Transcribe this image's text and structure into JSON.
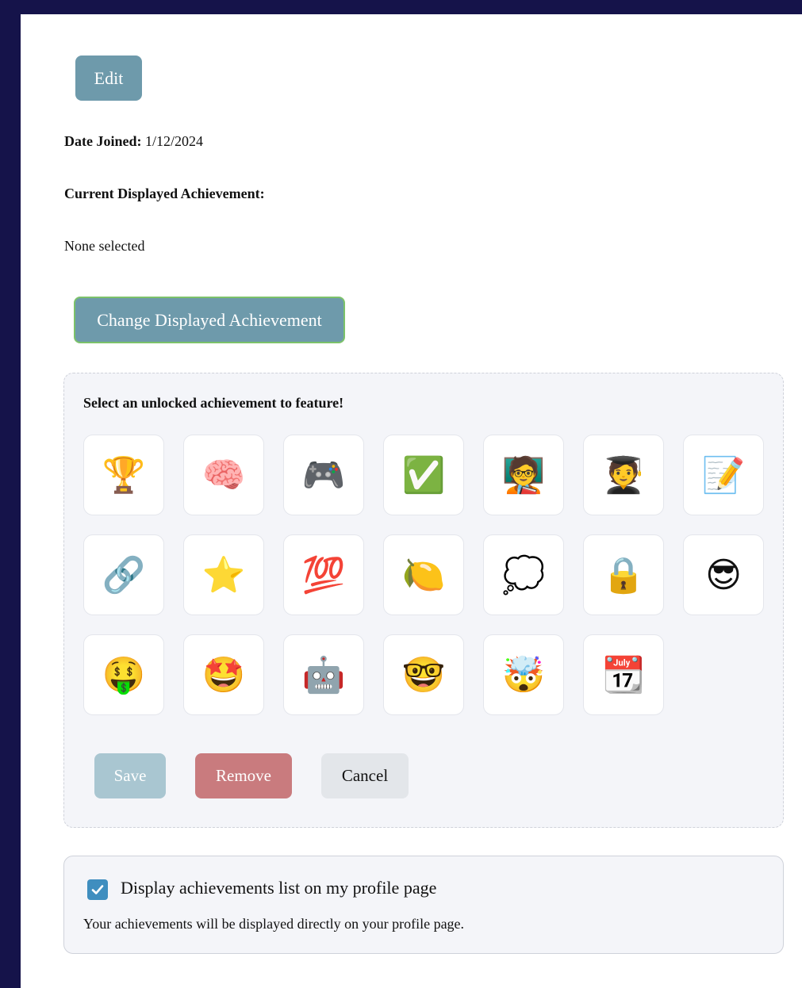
{
  "profile": {
    "edit_label": "Edit",
    "date_joined_label": "Date Joined:",
    "date_joined_value": "1/12/2024",
    "current_achievement_label": "Current Displayed Achievement:",
    "current_achievement_value": "None selected",
    "change_button_label": "Change Displayed Achievement"
  },
  "picker": {
    "title": "Select an unlocked achievement to feature!",
    "achievements": [
      {
        "emoji": "🏆",
        "icon": "trophy-icon"
      },
      {
        "emoji": "🧠",
        "icon": "brain-icon"
      },
      {
        "emoji": "🎮",
        "icon": "game-controller-icon"
      },
      {
        "emoji": "✅",
        "icon": "check-mark-icon"
      },
      {
        "emoji": "🧑‍🏫",
        "icon": "teacher-icon"
      },
      {
        "emoji": "🧑‍🎓",
        "icon": "graduate-icon"
      },
      {
        "emoji": "📝",
        "icon": "memo-icon"
      },
      {
        "emoji": "🔗",
        "icon": "link-icon"
      },
      {
        "emoji": "⭐",
        "icon": "star-icon"
      },
      {
        "emoji": "💯",
        "icon": "hundred-points-icon"
      },
      {
        "emoji": "🍋",
        "icon": "lemon-icon"
      },
      {
        "emoji": "💭",
        "icon": "thought-bubble-icon"
      },
      {
        "emoji": "🔒",
        "icon": "lock-icon"
      },
      {
        "emoji": "😎",
        "icon": "sunglasses-face-icon"
      },
      {
        "emoji": "🤑",
        "icon": "money-face-icon"
      },
      {
        "emoji": "🤩",
        "icon": "star-struck-icon"
      },
      {
        "emoji": "🤖",
        "icon": "robot-icon"
      },
      {
        "emoji": "🤓",
        "icon": "nerd-face-icon"
      },
      {
        "emoji": "🤯",
        "icon": "mind-blown-icon"
      },
      {
        "emoji": "📆",
        "icon": "calendar-icon"
      }
    ],
    "save_label": "Save",
    "remove_label": "Remove",
    "cancel_label": "Cancel"
  },
  "settings": {
    "checkbox_checked": true,
    "checkbox_label": "Display achievements list on my profile page",
    "description": "Your achievements will be displayed directly on your profile page."
  },
  "colors": {
    "primary_button": "#6e9aab",
    "remove_button": "#c97b7e",
    "checkbox": "#3f8ebf",
    "background": "#15134a"
  }
}
